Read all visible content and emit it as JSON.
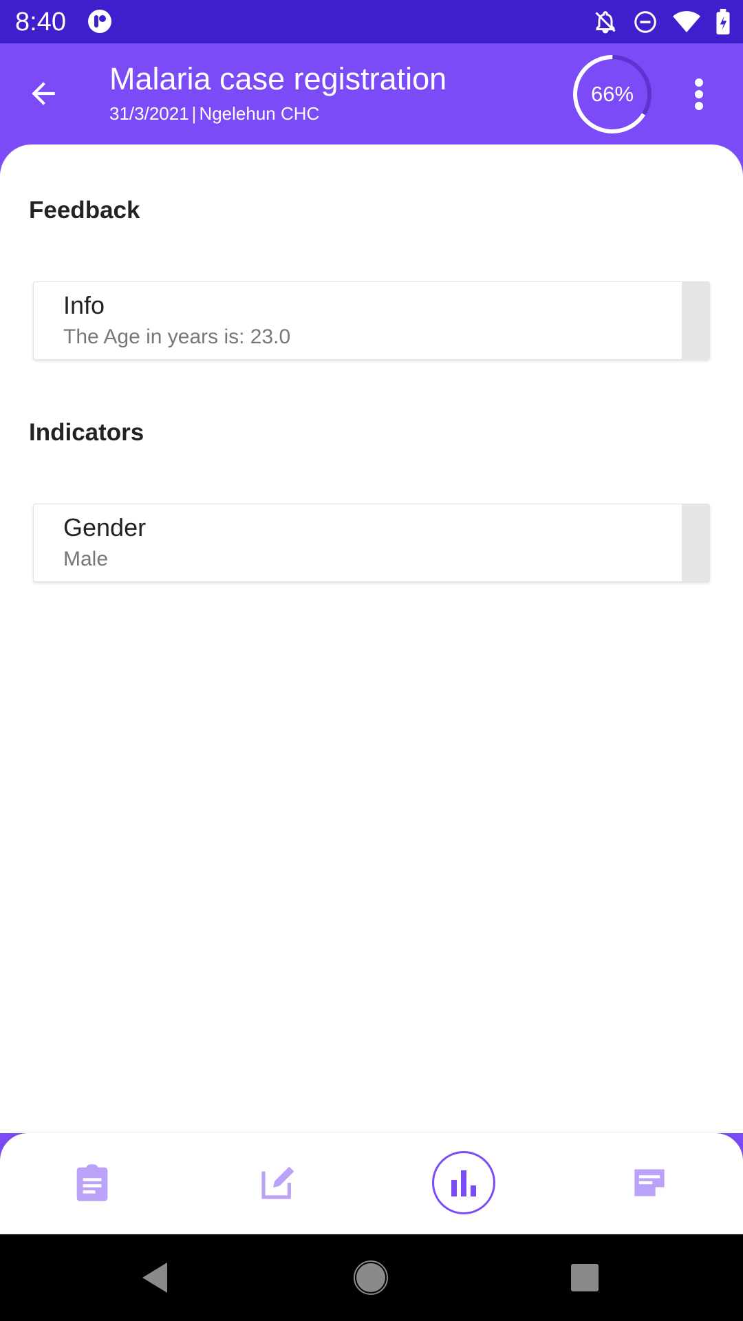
{
  "status_bar": {
    "time": "8:40",
    "icons": [
      "app-icon",
      "notifications-off-icon",
      "do-not-disturb-icon",
      "wifi-icon",
      "battery-charging-icon"
    ]
  },
  "toolbar": {
    "title": "Malaria case registration",
    "date": "31/3/2021",
    "separator": "|",
    "org_unit": "Ngelehun CHC",
    "progress_label": "66%",
    "progress_value": 0.66
  },
  "sections": {
    "feedback": {
      "title": "Feedback",
      "card": {
        "label": "Info",
        "value": "The Age in years is: 23.0"
      }
    },
    "indicators": {
      "title": "Indicators",
      "card": {
        "label": "Gender",
        "value": "Male"
      }
    }
  },
  "bottom_nav": {
    "items": [
      "details-icon",
      "data-entry-icon",
      "analytics-icon",
      "notes-icon"
    ],
    "active": "analytics-icon"
  },
  "colors": {
    "status_bar": "#3F1ECC",
    "primary": "#7B4BF7",
    "nav_icon": "#B9A2F7"
  }
}
